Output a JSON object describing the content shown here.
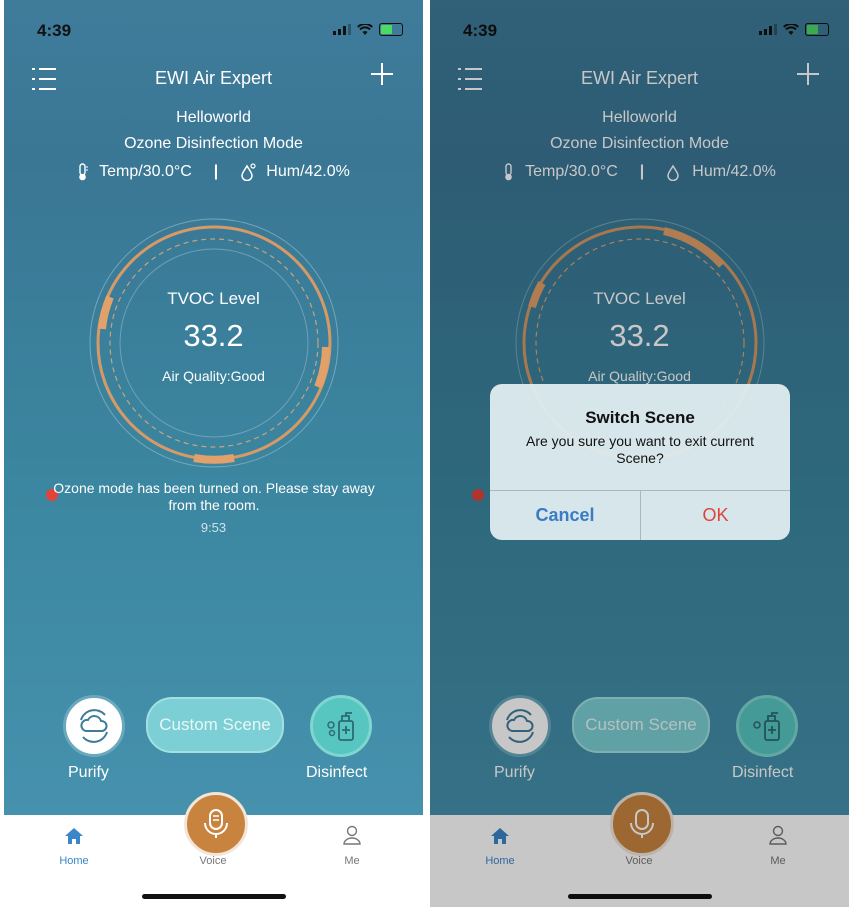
{
  "status": {
    "time": "4:39"
  },
  "header": {
    "title": "EWI Air Expert"
  },
  "device": {
    "name": "Helloworld",
    "mode": "Ozone Disinfection Mode",
    "temp": "Temp/30.0°C",
    "separator": "|",
    "hum": "Hum/42.0%"
  },
  "gauge": {
    "label": "TVOC Level",
    "value": "33.2",
    "quality": "Air Quality:Good"
  },
  "warning": {
    "text": "Ozone mode has been turned on. Please stay away from the room.",
    "timer": "9:53"
  },
  "scenes": {
    "purify": "Purify",
    "custom": "Custom Scene",
    "disinfect": "Disinfect"
  },
  "tabbar": {
    "home": "Home",
    "voice": "Voice",
    "me": "Me"
  },
  "dialog": {
    "title": "Switch Scene",
    "message": "Are you sure you want to exit current Scene?",
    "cancel": "Cancel",
    "ok": "OK"
  },
  "colors": {
    "accent": "#c8843e",
    "home_active": "#3a86c8",
    "warning_dot": "#e0433a",
    "cancel": "#3a7cc4",
    "ok": "#e0433a"
  }
}
